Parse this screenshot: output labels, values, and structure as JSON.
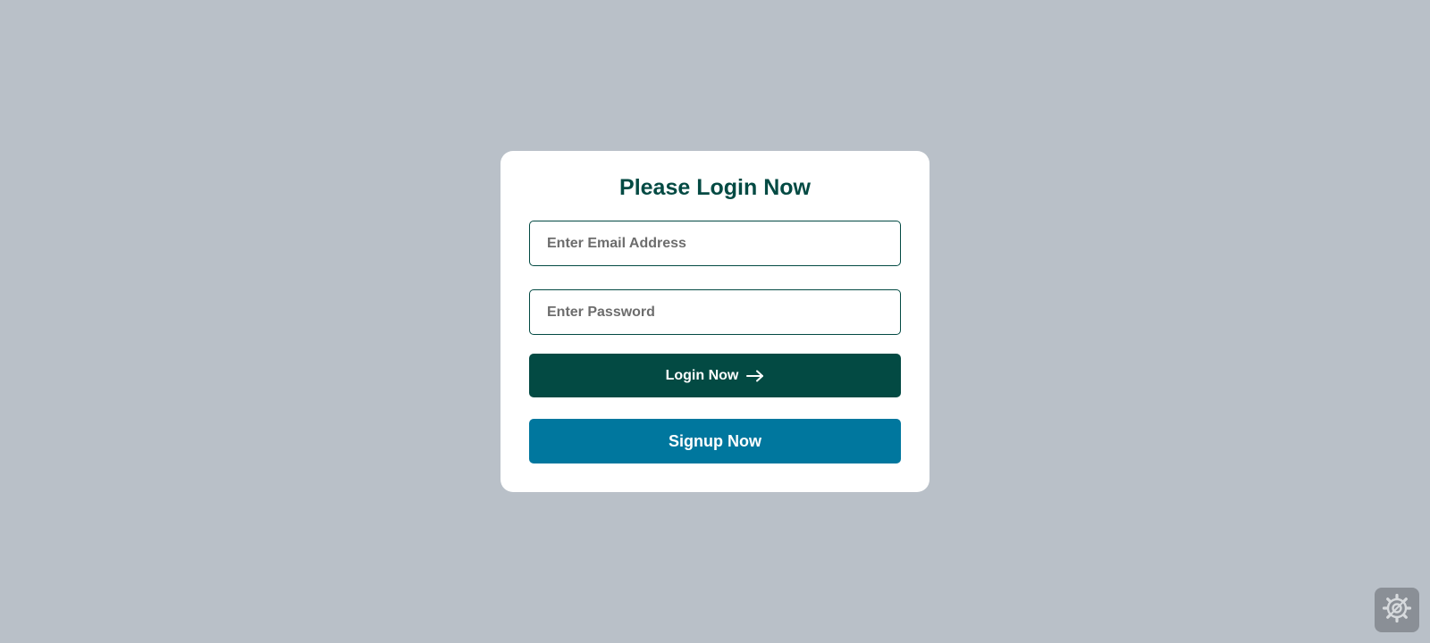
{
  "login_card": {
    "title": "Please Login Now",
    "email_field": {
      "placeholder": "Enter Email Address",
      "value": ""
    },
    "password_field": {
      "placeholder": "Enter Password",
      "value": ""
    },
    "login_button": {
      "label": "Login Now",
      "icon": "arrow-right-icon"
    },
    "signup_button": {
      "label": "Signup Now"
    }
  },
  "floating_widget": {
    "icon": "gear-icon"
  },
  "colors": {
    "background": "#b9c0c8",
    "card": "#ffffff",
    "primary_dark_green": "#034a43",
    "signup_blue": "#00779e",
    "widget_gray": "#8a8f96"
  }
}
